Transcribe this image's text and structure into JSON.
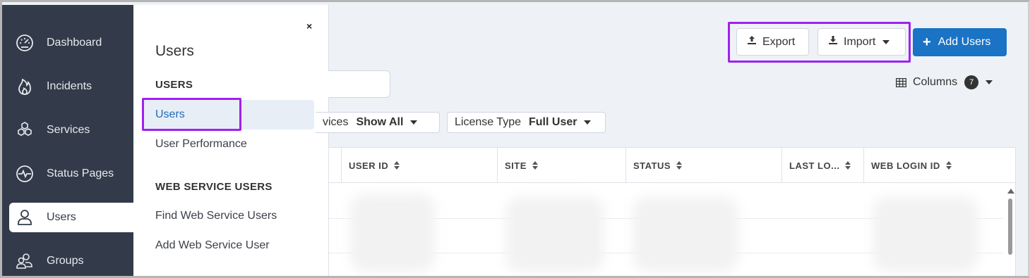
{
  "nav": {
    "items": [
      {
        "label": "Dashboard",
        "icon": "speedometer-icon"
      },
      {
        "label": "Incidents",
        "icon": "flame-icon"
      },
      {
        "label": "Services",
        "icon": "hexagons-icon"
      },
      {
        "label": "Status Pages",
        "icon": "pulse-icon"
      },
      {
        "label": "Users",
        "icon": "user-icon",
        "active": true
      },
      {
        "label": "Groups",
        "icon": "group-icon"
      }
    ]
  },
  "flyout": {
    "close": "×",
    "title": "Users",
    "section_users": "USERS",
    "link_users": "Users",
    "link_user_performance": "User Performance",
    "section_web": "WEB SERVICE USERS",
    "link_find_web": "Find Web Service Users",
    "link_add_web": "Add Web Service User"
  },
  "toolbar": {
    "export_label": "Export",
    "import_label": "Import",
    "add_users_label": "Add Users",
    "columns_label": "Columns",
    "columns_count": "7"
  },
  "filters": {
    "services_label": "vices",
    "services_value": "Show All",
    "license_label": "License Type",
    "license_value": "Full User"
  },
  "table": {
    "headers": [
      "USER ID",
      "SITE",
      "STATUS",
      "LAST LO...",
      "WEB LOGIN ID"
    ]
  },
  "colors": {
    "nav_bg": "#333b4a",
    "primary": "#1a73c5",
    "highlight": "#a020f0",
    "link_active": "#1f6db5"
  }
}
